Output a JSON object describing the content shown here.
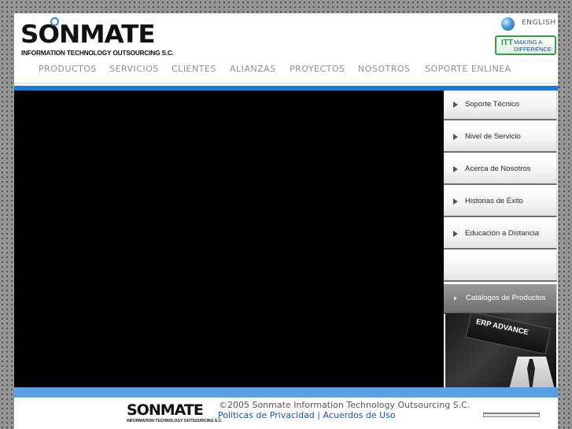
{
  "brand": {
    "name": "SONMATE",
    "tagline": "INFORMATION TECHNOLOGY OUTSOURCING S.C.",
    "ring_color": "#3a86c7"
  },
  "language": {
    "label": "ENGLISH",
    "icon": "globe-icon"
  },
  "badge": {
    "mark": "ITT",
    "text_line1": "MAKING A",
    "text_line2": "DIFFERENCE"
  },
  "nav": {
    "items": [
      {
        "label": "PRODUCTOS"
      },
      {
        "label": "SERVICIOS"
      },
      {
        "label": "CLIENTES"
      },
      {
        "label": "ALIANZAS"
      },
      {
        "label": "PROYECTOS"
      },
      {
        "label": "NOSOTROS"
      },
      {
        "label": "SOPORTE ENLINEA"
      }
    ]
  },
  "sidebar": {
    "items": [
      {
        "label": "Soporte Técnico"
      },
      {
        "label": "Nivel de Servicio"
      },
      {
        "label": "Acerca de Nosotros"
      },
      {
        "label": "Historias de Éxito"
      },
      {
        "label": "Educación a Distancia"
      },
      {
        "label": ""
      },
      {
        "label": "Catálogos de Productos"
      }
    ],
    "promo": {
      "title": "ERP ADVANCE"
    }
  },
  "footer": {
    "logo_word": "SONMATE",
    "logo_sub": "INFORMATION TECHNOLOGY OUTSOURCING S.C.",
    "copyright": "©2005 Sonmate Information Technology Outsourcing S.C.",
    "link_privacy": "Politicas de Privacidad",
    "separator": "|",
    "link_terms": "Acuerdos de Uso"
  },
  "colors": {
    "accent_blue": "#1f78d2",
    "light_blue": "#5e9fe3",
    "link_blue": "#1a50b0"
  }
}
